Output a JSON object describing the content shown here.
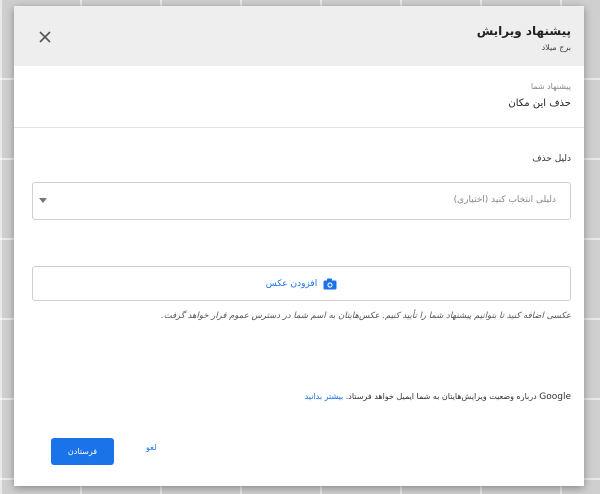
{
  "dialog": {
    "title": "پیشنهاد ویرایش",
    "subtitle": "برج میلاد",
    "close_icon": "close-icon"
  },
  "suggestion": {
    "label": "پیشنهاد شما",
    "value": "حذف این مکان"
  },
  "reason": {
    "label": "دلیل حذف",
    "placeholder": "دلیلی انتخاب کنید (اختیاری)"
  },
  "photo": {
    "button_label": "افزودن عکس",
    "icon": "camera-icon",
    "help_text": "عکسی اضافه کنید تا بتوانیم پیشنهاد شما را تأیید کنیم. عکس‌هایتان به اسم شما در دسترس عموم قرار خواهد گرفت."
  },
  "email_note": {
    "brand": "Google",
    "text": " درباره وضعیت ویرایش‌هایتان به شما ایمیل خواهد فرستاد. ",
    "link": "بیشتر بدانید"
  },
  "actions": {
    "send_label": "فرستادن",
    "cancel_label": "لغو"
  },
  "colors": {
    "accent": "#1a73e8",
    "header_bg": "#eeeeee"
  }
}
